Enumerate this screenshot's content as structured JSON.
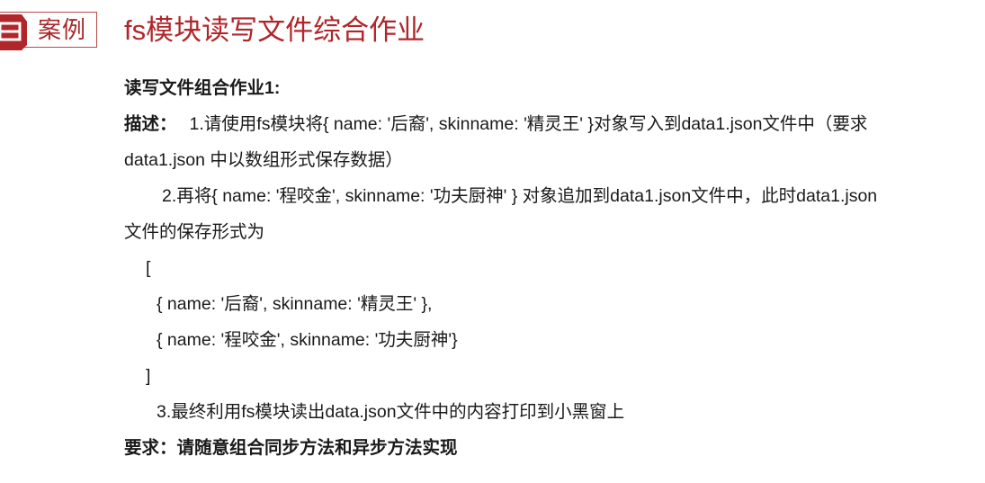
{
  "header": {
    "tag_label": "案例",
    "tag_icon": "book-icon",
    "title": "fs模块读写文件综合作业"
  },
  "content": {
    "heading": "读写文件组合作业1:",
    "desc_label": "描述：",
    "step1_line1": "1.请使用fs模块将{ name: '后裔', skinname: '精灵王' }对象写入到data1.json文件中（要求",
    "step1_line2": "data1.json 中以数组形式保存数据）",
    "step2_line1": "2.再将{ name: '程咬金', skinname: '功夫厨神' } 对象追加到data1.json文件中，此时data1.json",
    "step2_line2": "文件的保存形式为",
    "code_open": "[",
    "code_item1": "{ name: '后裔', skinname: '精灵王' },",
    "code_item2": "{ name: '程咬金', skinname: '功夫厨神'}",
    "code_close": "]",
    "step3": "3.最终利用fs模块读出data.json文件中的内容打印到小黑窗上",
    "requirement": "要求：请随意组合同步方法和异步方法实现"
  },
  "colors": {
    "accent": "#b0262a",
    "tag_border": "#b84a4a",
    "text": "#1a1a1a"
  }
}
